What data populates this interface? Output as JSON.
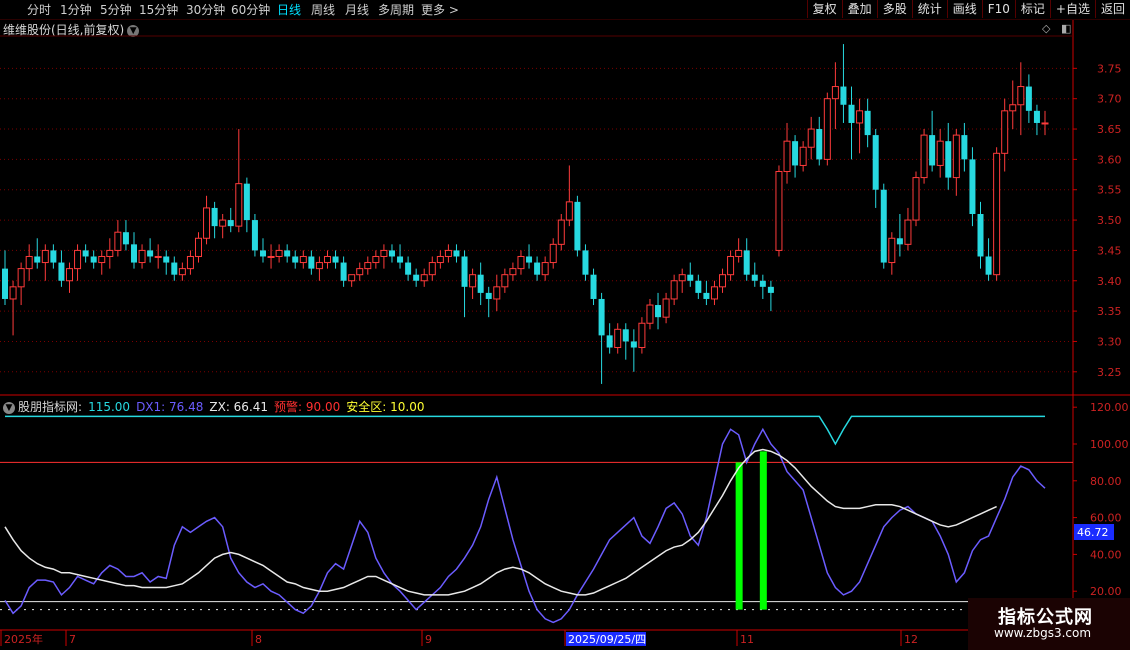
{
  "timeframes": [
    "分时",
    "1分钟",
    "5分钟",
    "15分钟",
    "30分钟",
    "60分钟",
    "日线",
    "周线",
    "月线",
    "多周期",
    "更多 >"
  ],
  "active_timeframe": "日线",
  "right_buttons": [
    "复权",
    "叠加",
    "多股",
    "统计",
    "画线",
    "F10",
    "标记",
    "+自选",
    "返回"
  ],
  "title": "维维股份(日线,前复权)",
  "chevron_icon": "chevron-down-icon",
  "corner_icons": [
    "diamond-icon",
    "split-panel-icon"
  ],
  "price_axis": [
    "3.75",
    "3.70",
    "3.65",
    "3.60",
    "3.55",
    "3.50",
    "3.45",
    "3.40",
    "3.35",
    "3.30",
    "3.25"
  ],
  "indicator": {
    "name": "股朋指标网",
    "sep": ":",
    "values": [
      {
        "label": "115.00",
        "color": "#27d9e0"
      },
      {
        "label": "DX1: 76.48",
        "color": "#6b5cff"
      },
      {
        "label": "ZX: 66.41",
        "color": "#e8e8e8"
      },
      {
        "label": "预警: 90.00",
        "color": "#ff3030"
      },
      {
        "label": "安全区: 10.00",
        "color": "#ffff33"
      }
    ]
  },
  "ind_axis": [
    "120.00",
    "100.00",
    "80.00",
    "60.00",
    "40.00",
    "20.00"
  ],
  "current_value": "46.72",
  "dates": [
    "2025年",
    "7",
    "8",
    "9",
    "2025/09/25/四",
    "11",
    "12"
  ],
  "watermark": {
    "line1": "指标公式网",
    "line2": "www.zbgs3.com"
  },
  "colors": {
    "up": "#ff3b3b",
    "down": "#27d9e0",
    "grid": "#7a0000",
    "axis": "#cc0000"
  },
  "chart_data": [
    {
      "type": "candlestick",
      "title": "维维股份(日线,前复权)",
      "ylim": [
        3.22,
        3.8
      ],
      "candles": [
        [
          3.42,
          3.45,
          3.36,
          3.37
        ],
        [
          3.37,
          3.4,
          3.31,
          3.39
        ],
        [
          3.39,
          3.43,
          3.36,
          3.42
        ],
        [
          3.42,
          3.46,
          3.4,
          3.44
        ],
        [
          3.44,
          3.47,
          3.42,
          3.43
        ],
        [
          3.43,
          3.46,
          3.4,
          3.45
        ],
        [
          3.45,
          3.46,
          3.42,
          3.43
        ],
        [
          3.43,
          3.45,
          3.39,
          3.4
        ],
        [
          3.4,
          3.43,
          3.38,
          3.42
        ],
        [
          3.42,
          3.46,
          3.4,
          3.45
        ],
        [
          3.45,
          3.46,
          3.43,
          3.44
        ],
        [
          3.44,
          3.45,
          3.42,
          3.43
        ],
        [
          3.43,
          3.45,
          3.41,
          3.44
        ],
        [
          3.44,
          3.47,
          3.42,
          3.45
        ],
        [
          3.45,
          3.5,
          3.44,
          3.48
        ],
        [
          3.48,
          3.5,
          3.45,
          3.46
        ],
        [
          3.46,
          3.48,
          3.42,
          3.43
        ],
        [
          3.43,
          3.46,
          3.42,
          3.45
        ],
        [
          3.45,
          3.47,
          3.43,
          3.44
        ],
        [
          3.44,
          3.46,
          3.42,
          3.44
        ],
        [
          3.44,
          3.45,
          3.41,
          3.43
        ],
        [
          3.43,
          3.44,
          3.4,
          3.41
        ],
        [
          3.41,
          3.43,
          3.4,
          3.42
        ],
        [
          3.42,
          3.45,
          3.41,
          3.44
        ],
        [
          3.44,
          3.48,
          3.43,
          3.47
        ],
        [
          3.47,
          3.54,
          3.46,
          3.52
        ],
        [
          3.52,
          3.53,
          3.47,
          3.49
        ],
        [
          3.49,
          3.51,
          3.47,
          3.5
        ],
        [
          3.5,
          3.52,
          3.48,
          3.49
        ],
        [
          3.49,
          3.65,
          3.48,
          3.56
        ],
        [
          3.56,
          3.57,
          3.48,
          3.5
        ],
        [
          3.5,
          3.51,
          3.44,
          3.45
        ],
        [
          3.45,
          3.47,
          3.43,
          3.44
        ],
        [
          3.44,
          3.46,
          3.42,
          3.44
        ],
        [
          3.44,
          3.46,
          3.43,
          3.45
        ],
        [
          3.45,
          3.46,
          3.43,
          3.44
        ],
        [
          3.44,
          3.45,
          3.42,
          3.43
        ],
        [
          3.43,
          3.45,
          3.42,
          3.44
        ],
        [
          3.44,
          3.45,
          3.41,
          3.42
        ],
        [
          3.42,
          3.44,
          3.4,
          3.43
        ],
        [
          3.43,
          3.45,
          3.42,
          3.44
        ],
        [
          3.44,
          3.45,
          3.42,
          3.43
        ],
        [
          3.43,
          3.44,
          3.39,
          3.4
        ],
        [
          3.4,
          3.41,
          3.39,
          3.41
        ],
        [
          3.41,
          3.43,
          3.4,
          3.42
        ],
        [
          3.42,
          3.44,
          3.41,
          3.43
        ],
        [
          3.43,
          3.45,
          3.42,
          3.44
        ],
        [
          3.44,
          3.46,
          3.42,
          3.45
        ],
        [
          3.45,
          3.46,
          3.43,
          3.44
        ],
        [
          3.44,
          3.46,
          3.42,
          3.43
        ],
        [
          3.43,
          3.44,
          3.4,
          3.41
        ],
        [
          3.41,
          3.42,
          3.39,
          3.4
        ],
        [
          3.4,
          3.42,
          3.39,
          3.41
        ],
        [
          3.41,
          3.44,
          3.4,
          3.43
        ],
        [
          3.43,
          3.45,
          3.42,
          3.44
        ],
        [
          3.44,
          3.46,
          3.43,
          3.45
        ],
        [
          3.45,
          3.46,
          3.43,
          3.44
        ],
        [
          3.44,
          3.45,
          3.34,
          3.39
        ],
        [
          3.39,
          3.42,
          3.37,
          3.41
        ],
        [
          3.41,
          3.43,
          3.36,
          3.38
        ],
        [
          3.38,
          3.39,
          3.34,
          3.37
        ],
        [
          3.37,
          3.41,
          3.35,
          3.39
        ],
        [
          3.39,
          3.42,
          3.38,
          3.41
        ],
        [
          3.41,
          3.43,
          3.4,
          3.42
        ],
        [
          3.42,
          3.45,
          3.41,
          3.44
        ],
        [
          3.44,
          3.46,
          3.42,
          3.43
        ],
        [
          3.43,
          3.44,
          3.4,
          3.41
        ],
        [
          3.41,
          3.44,
          3.4,
          3.43
        ],
        [
          3.43,
          3.47,
          3.42,
          3.46
        ],
        [
          3.46,
          3.51,
          3.45,
          3.5
        ],
        [
          3.5,
          3.59,
          3.49,
          3.53
        ],
        [
          3.53,
          3.54,
          3.44,
          3.45
        ],
        [
          3.45,
          3.46,
          3.4,
          3.41
        ],
        [
          3.41,
          3.42,
          3.36,
          3.37
        ],
        [
          3.37,
          3.38,
          3.23,
          3.31
        ],
        [
          3.31,
          3.33,
          3.28,
          3.29
        ],
        [
          3.29,
          3.33,
          3.28,
          3.32
        ],
        [
          3.32,
          3.33,
          3.27,
          3.3
        ],
        [
          3.3,
          3.32,
          3.25,
          3.29
        ],
        [
          3.29,
          3.34,
          3.28,
          3.33
        ],
        [
          3.33,
          3.37,
          3.32,
          3.36
        ],
        [
          3.36,
          3.38,
          3.32,
          3.34
        ],
        [
          3.34,
          3.38,
          3.33,
          3.37
        ],
        [
          3.37,
          3.41,
          3.36,
          3.4
        ],
        [
          3.4,
          3.42,
          3.38,
          3.41
        ],
        [
          3.41,
          3.43,
          3.39,
          3.4
        ],
        [
          3.4,
          3.41,
          3.37,
          3.38
        ],
        [
          3.38,
          3.4,
          3.36,
          3.37
        ],
        [
          3.37,
          3.4,
          3.36,
          3.39
        ],
        [
          3.39,
          3.42,
          3.38,
          3.41
        ],
        [
          3.41,
          3.45,
          3.4,
          3.44
        ],
        [
          3.44,
          3.47,
          3.43,
          3.45
        ],
        [
          3.45,
          3.47,
          3.4,
          3.41
        ],
        [
          3.41,
          3.43,
          3.39,
          3.4
        ],
        [
          3.4,
          3.41,
          3.37,
          3.39
        ],
        [
          3.39,
          3.4,
          3.35,
          3.38
        ],
        [
          3.45,
          3.59,
          3.44,
          3.58
        ],
        [
          3.58,
          3.66,
          3.56,
          3.63
        ],
        [
          3.63,
          3.64,
          3.57,
          3.59
        ],
        [
          3.59,
          3.63,
          3.58,
          3.62
        ],
        [
          3.62,
          3.67,
          3.6,
          3.65
        ],
        [
          3.65,
          3.67,
          3.59,
          3.6
        ],
        [
          3.6,
          3.71,
          3.59,
          3.7
        ],
        [
          3.7,
          3.76,
          3.65,
          3.72
        ],
        [
          3.72,
          3.79,
          3.66,
          3.69
        ],
        [
          3.69,
          3.72,
          3.6,
          3.66
        ],
        [
          3.66,
          3.7,
          3.61,
          3.68
        ],
        [
          3.68,
          3.7,
          3.62,
          3.64
        ],
        [
          3.64,
          3.65,
          3.52,
          3.55
        ],
        [
          3.55,
          3.56,
          3.42,
          3.43
        ],
        [
          3.43,
          3.48,
          3.41,
          3.47
        ],
        [
          3.47,
          3.51,
          3.44,
          3.46
        ],
        [
          3.46,
          3.52,
          3.45,
          3.5
        ],
        [
          3.5,
          3.58,
          3.49,
          3.57
        ],
        [
          3.57,
          3.65,
          3.56,
          3.64
        ],
        [
          3.64,
          3.68,
          3.58,
          3.59
        ],
        [
          3.59,
          3.65,
          3.57,
          3.63
        ],
        [
          3.63,
          3.66,
          3.55,
          3.57
        ],
        [
          3.57,
          3.65,
          3.54,
          3.64
        ],
        [
          3.64,
          3.66,
          3.58,
          3.6
        ],
        [
          3.6,
          3.62,
          3.49,
          3.51
        ],
        [
          3.51,
          3.53,
          3.42,
          3.44
        ],
        [
          3.44,
          3.47,
          3.4,
          3.41
        ],
        [
          3.41,
          3.62,
          3.4,
          3.61
        ],
        [
          3.61,
          3.7,
          3.58,
          3.68
        ],
        [
          3.68,
          3.73,
          3.65,
          3.69
        ],
        [
          3.69,
          3.76,
          3.64,
          3.72
        ],
        [
          3.72,
          3.74,
          3.66,
          3.68
        ],
        [
          3.68,
          3.69,
          3.64,
          3.66
        ],
        [
          3.66,
          3.68,
          3.64,
          3.66
        ]
      ]
    },
    {
      "type": "line",
      "title": "股朋指标网",
      "ylim": [
        0,
        125
      ],
      "series": [
        {
          "name": "DX1",
          "color": "#6b5cff",
          "values": [
            15,
            8,
            12,
            22,
            26,
            26,
            25,
            18,
            22,
            28,
            26,
            24,
            30,
            34,
            32,
            28,
            28,
            30,
            25,
            28,
            27,
            45,
            55,
            52,
            55,
            58,
            60,
            55,
            38,
            30,
            25,
            22,
            24,
            20,
            18,
            14,
            10,
            8,
            12,
            20,
            30,
            35,
            32,
            45,
            58,
            52,
            38,
            30,
            24,
            20,
            15,
            10,
            14,
            18,
            22,
            28,
            32,
            38,
            45,
            55,
            70,
            82,
            65,
            48,
            34,
            20,
            10,
            5,
            3,
            5,
            10,
            18,
            25,
            32,
            40,
            48,
            52,
            56,
            60,
            50,
            46,
            55,
            65,
            68,
            62,
            50,
            45,
            60,
            80,
            100,
            108,
            105,
            90,
            100,
            108,
            100,
            95,
            85,
            80,
            75,
            60,
            45,
            30,
            22,
            18,
            20,
            25,
            35,
            45,
            55,
            60,
            64,
            66,
            62,
            60,
            58,
            50,
            40,
            25,
            30,
            42,
            48,
            50,
            60,
            70,
            82,
            88,
            86,
            80,
            76
          ]
        },
        {
          "name": "ZX",
          "color": "#e8e8e8",
          "values": [
            55,
            48,
            42,
            38,
            35,
            33,
            32,
            30,
            30,
            29,
            28,
            27,
            26,
            25,
            24,
            23,
            23,
            22,
            22,
            22,
            22,
            23,
            24,
            27,
            30,
            34,
            38,
            40,
            41,
            40,
            38,
            36,
            34,
            31,
            28,
            25,
            24,
            22,
            21,
            20,
            20,
            21,
            22,
            24,
            26,
            28,
            28,
            26,
            24,
            22,
            20,
            19,
            18,
            18,
            18,
            18,
            19,
            20,
            22,
            24,
            27,
            30,
            32,
            33,
            32,
            30,
            27,
            24,
            22,
            20,
            19,
            18,
            18,
            19,
            21,
            23,
            25,
            27,
            30,
            33,
            36,
            39,
            42,
            44,
            45,
            48,
            52,
            58,
            65,
            72,
            80,
            87,
            92,
            96,
            97,
            96,
            94,
            91,
            87,
            82,
            77,
            73,
            69,
            66,
            65,
            65,
            65,
            66,
            67,
            67,
            67,
            66,
            64,
            62,
            60,
            58,
            56,
            55,
            56,
            58,
            60,
            62,
            64,
            66
          ]
        }
      ],
      "reference_lines": [
        {
          "name": "115.00",
          "value": 115,
          "color": "#27d9e0"
        },
        {
          "name": "预警",
          "value": 90,
          "color": "#ff3030"
        },
        {
          "name": "安全区",
          "value": 10,
          "color": "#ffff33"
        }
      ],
      "signal_bars": [
        {
          "index": 91,
          "from": 10,
          "to": 90,
          "color": "#00ff00"
        },
        {
          "index": 94,
          "from": 10,
          "to": 96,
          "color": "#00ff00"
        }
      ]
    }
  ]
}
